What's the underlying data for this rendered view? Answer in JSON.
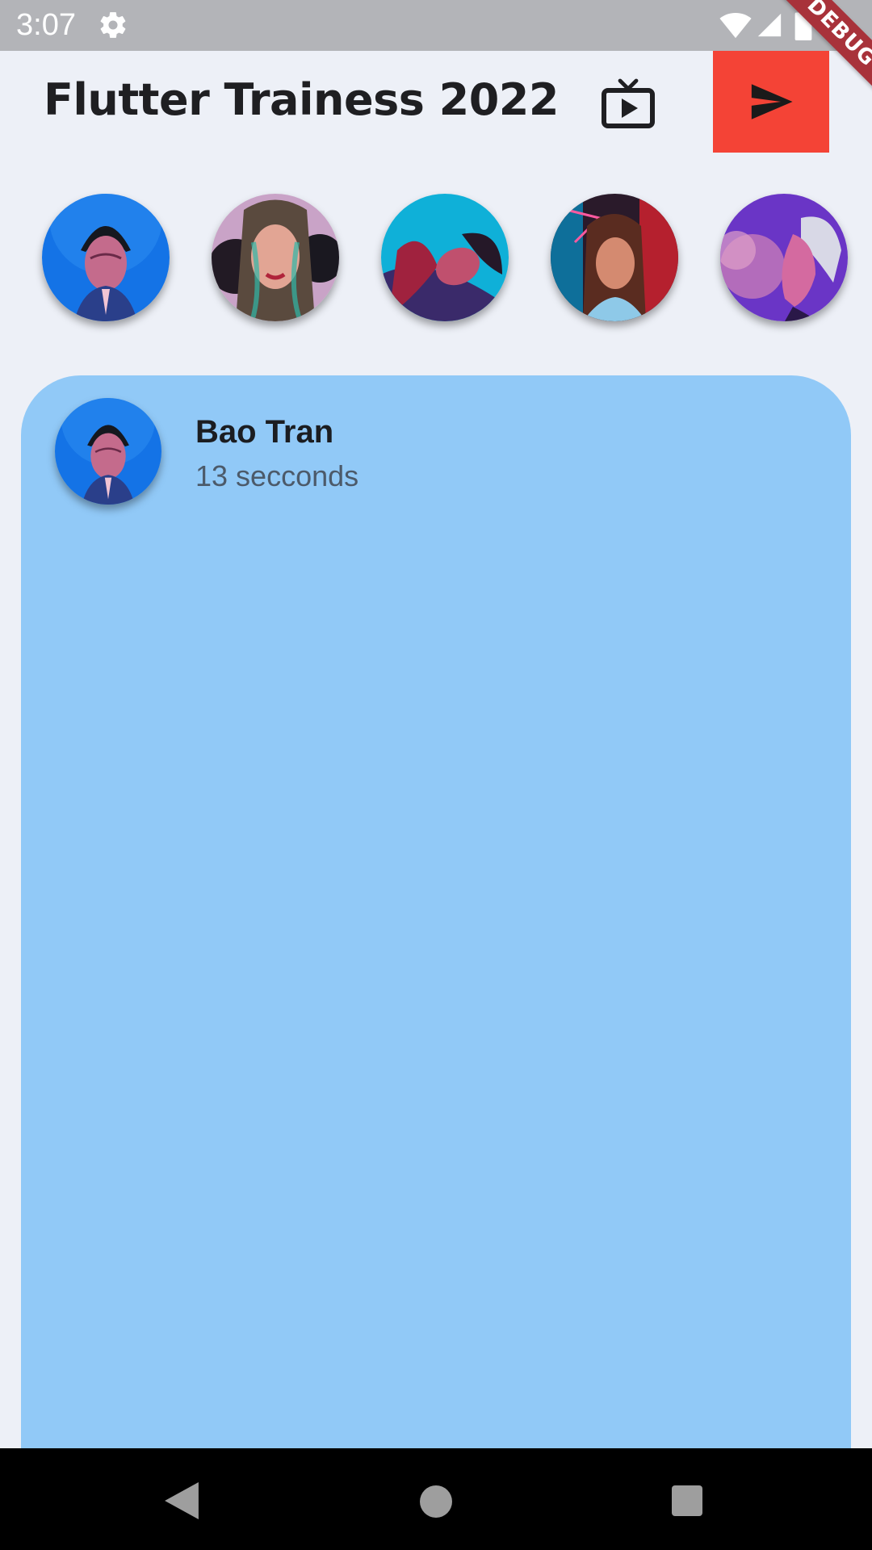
{
  "status_bar": {
    "time": "3:07",
    "icons": [
      "gear-icon",
      "wifi-icon",
      "cell-signal-icon",
      "battery-icon"
    ]
  },
  "debug_banner": {
    "label": "DEBUG"
  },
  "header": {
    "title": "Flutter Trainess 2022",
    "actions": [
      "live-tv-icon",
      "send-icon"
    ],
    "send_button_color": "#f44336"
  },
  "stories": [
    {
      "avatar": "story-avatar-man-blue"
    },
    {
      "avatar": "story-avatar-woman-pink"
    },
    {
      "avatar": "story-avatar-woman-cyan"
    },
    {
      "avatar": "story-avatar-woman-neon"
    },
    {
      "avatar": "story-avatar-woman-purple"
    }
  ],
  "feed": {
    "card_color": "#91c9f7",
    "post": {
      "author": "Bao Tran",
      "time": "13 secconds"
    }
  },
  "navigation_bar": {
    "buttons": [
      "back-icon",
      "home-icon",
      "recents-icon"
    ]
  },
  "colors": {
    "background": "#edf0f7",
    "status_bar": "#b3b4b8",
    "title": "#1f1f22"
  }
}
